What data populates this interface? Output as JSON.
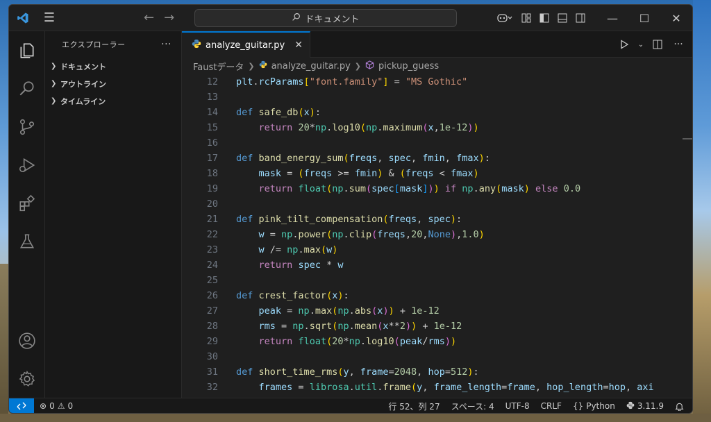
{
  "titlebar": {
    "search_text": "ドキュメント",
    "icons": [
      "vscode-logo-icon",
      "menu-icon",
      "back-arrow-icon",
      "forward-arrow-icon",
      "search-icon",
      "copilot-icon",
      "layout-customize-icon",
      "toggle-sidebar-icon",
      "toggle-panel-icon",
      "toggle-secondary-sidebar-icon",
      "minimize-icon",
      "maximize-icon",
      "close-icon"
    ]
  },
  "activity": [
    "explorer-icon",
    "search-icon",
    "source-control-icon",
    "run-debug-icon",
    "extensions-icon",
    "testing-icon",
    "accounts-icon",
    "settings-gear-icon"
  ],
  "sidebar": {
    "title": "エクスプローラー",
    "sections": [
      "ドキュメント",
      "アウトライン",
      "タイムライン"
    ]
  },
  "tab": {
    "name": "analyze_guitar.py"
  },
  "breadcrumb": {
    "folder": "Faustデータ",
    "file": "analyze_guitar.py",
    "symbol": "pickup_guess"
  },
  "code": {
    "line_numbers": [
      "12",
      "13",
      "14",
      "15",
      "16",
      "17",
      "18",
      "19",
      "20",
      "21",
      "22",
      "23",
      "24",
      "25",
      "26",
      "27",
      "28",
      "29",
      "30",
      "31",
      "32"
    ]
  },
  "status": {
    "errors": "0",
    "warnings": "0",
    "position": "行 52、列 27",
    "spaces": "スペース: 4",
    "encoding": "UTF-8",
    "eol": "CRLF",
    "language": "Python",
    "interpreter": "3.11.9"
  },
  "colors": {
    "accent": "#0078d4",
    "editor_bg": "#1f1f1f",
    "sidebar_bg": "#181818"
  }
}
